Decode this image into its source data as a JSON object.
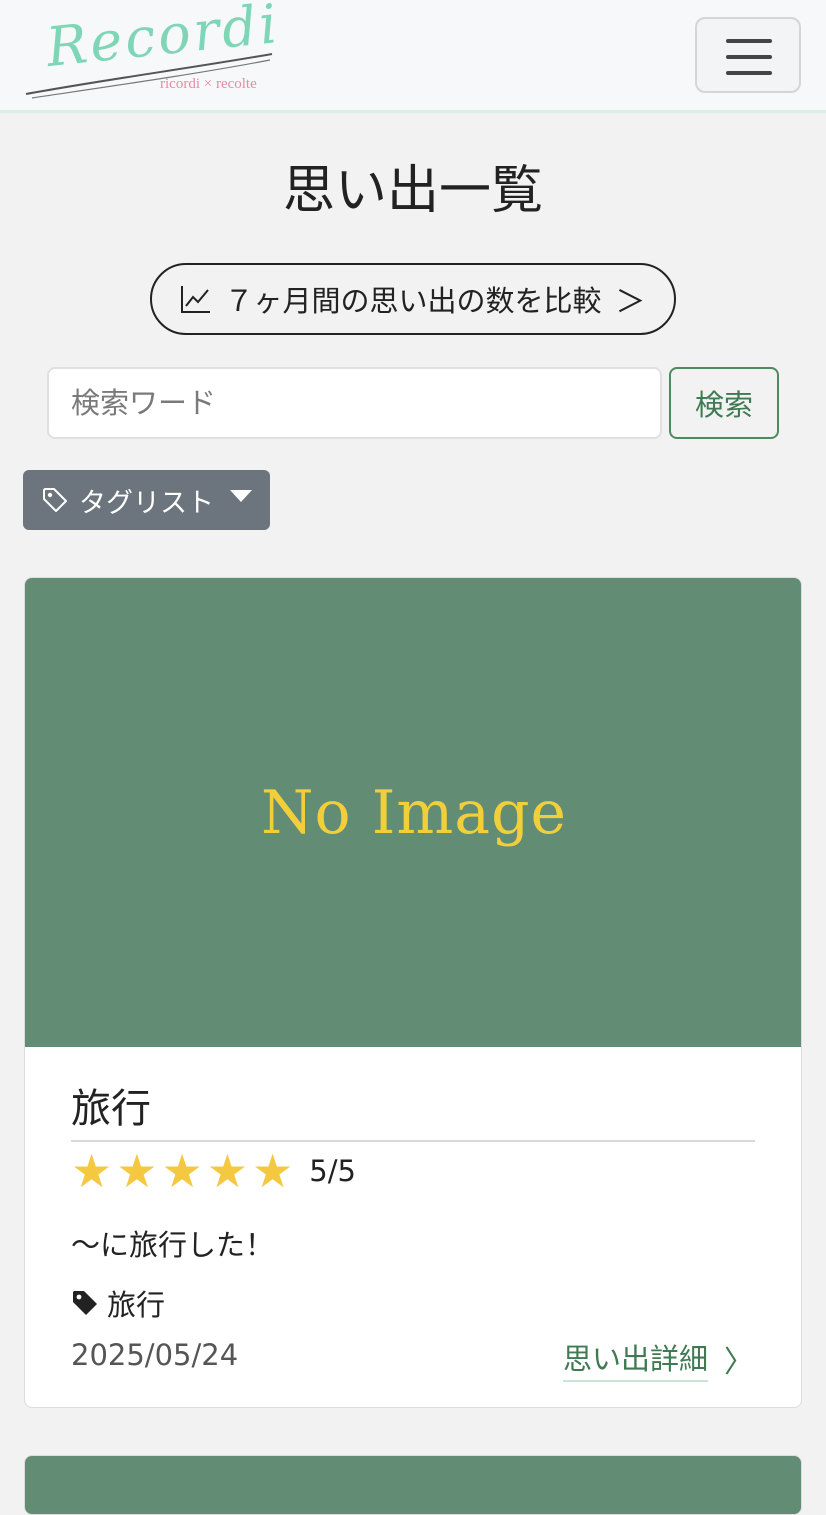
{
  "navbar": {
    "logo_text": "Recordi",
    "logo_subtitle": "ricordi × recolte",
    "colors": {
      "logo_main": "#7fd6b6",
      "logo_sub": "#e58ba4"
    }
  },
  "page_title": "思い出一覧",
  "compare_button": {
    "icon": "line-chart-icon",
    "label": "７ヶ月間の思い出の数を比較",
    "chevron": "＞"
  },
  "search": {
    "placeholder": "検索ワード",
    "value": "",
    "button_label": "検索"
  },
  "tag_list": {
    "icon": "tag-outline-icon",
    "label": "タグリスト",
    "caret": "caret-down-icon"
  },
  "cards": [
    {
      "image_text": "No Image",
      "title": "旅行",
      "rating": {
        "stars": 5,
        "max": 5,
        "text": "5/5"
      },
      "body": "〜に旅行した！",
      "tag": "旅行",
      "date": "2025/05/24",
      "detail_label": "思い出詳細",
      "detail_chevron": "〉"
    }
  ],
  "colors": {
    "accent_green": "#3f7a52",
    "card_image_bg": "#628c74",
    "no_image_text": "#f2cf3a",
    "star": "#f5c842",
    "tag_button_bg": "#6c757d"
  }
}
